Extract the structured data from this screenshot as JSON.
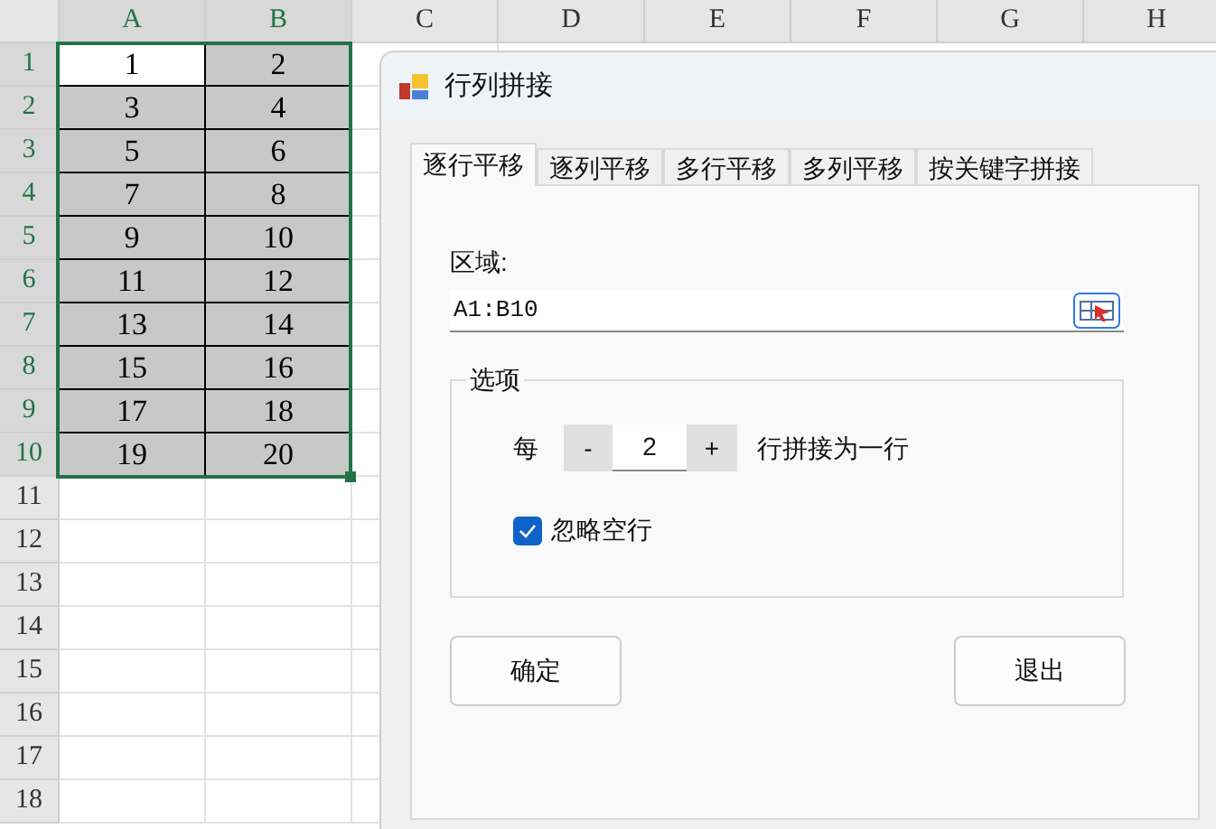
{
  "sheet": {
    "columns": [
      {
        "label": "A",
        "selected": true
      },
      {
        "label": "B",
        "selected": true
      },
      {
        "label": "C",
        "selected": false
      },
      {
        "label": "D",
        "selected": false
      },
      {
        "label": "E",
        "selected": false
      },
      {
        "label": "F",
        "selected": false
      },
      {
        "label": "G",
        "selected": false
      },
      {
        "label": "H",
        "selected": false
      }
    ],
    "rows": [
      {
        "label": "1",
        "selected": true,
        "cells": [
          {
            "value": "1",
            "active": true
          },
          {
            "value": "2",
            "active": false
          }
        ]
      },
      {
        "label": "2",
        "selected": true,
        "cells": [
          {
            "value": "3",
            "active": false
          },
          {
            "value": "4",
            "active": false
          }
        ]
      },
      {
        "label": "3",
        "selected": true,
        "cells": [
          {
            "value": "5",
            "active": false
          },
          {
            "value": "6",
            "active": false
          }
        ]
      },
      {
        "label": "4",
        "selected": true,
        "cells": [
          {
            "value": "7",
            "active": false
          },
          {
            "value": "8",
            "active": false
          }
        ]
      },
      {
        "label": "5",
        "selected": true,
        "cells": [
          {
            "value": "9",
            "active": false
          },
          {
            "value": "10",
            "active": false
          }
        ]
      },
      {
        "label": "6",
        "selected": true,
        "cells": [
          {
            "value": "11",
            "active": false
          },
          {
            "value": "12",
            "active": false
          }
        ]
      },
      {
        "label": "7",
        "selected": true,
        "cells": [
          {
            "value": "13",
            "active": false
          },
          {
            "value": "14",
            "active": false
          }
        ]
      },
      {
        "label": "8",
        "selected": true,
        "cells": [
          {
            "value": "15",
            "active": false
          },
          {
            "value": "16",
            "active": false
          }
        ]
      },
      {
        "label": "9",
        "selected": true,
        "cells": [
          {
            "value": "17",
            "active": false
          },
          {
            "value": "18",
            "active": false
          }
        ]
      },
      {
        "label": "10",
        "selected": true,
        "cells": [
          {
            "value": "19",
            "active": false
          },
          {
            "value": "20",
            "active": false
          }
        ]
      },
      {
        "label": "11",
        "selected": false
      },
      {
        "label": "12",
        "selected": false
      },
      {
        "label": "13",
        "selected": false
      },
      {
        "label": "14",
        "selected": false
      },
      {
        "label": "15",
        "selected": false
      },
      {
        "label": "16",
        "selected": false
      },
      {
        "label": "17",
        "selected": false
      },
      {
        "label": "18",
        "selected": false
      }
    ]
  },
  "dialog": {
    "title": "行列拼接",
    "tabs": [
      {
        "label": "逐行平移",
        "selected": true
      },
      {
        "label": "逐列平移",
        "selected": false
      },
      {
        "label": "多行平移",
        "selected": false
      },
      {
        "label": "多列平移",
        "selected": false
      },
      {
        "label": "按关键字拼接",
        "selected": false
      }
    ],
    "range_label": "区域:",
    "range_value": "A1:B10",
    "options": {
      "legend": "选项",
      "prefix": "每",
      "count": "2",
      "minus": "-",
      "plus": "+",
      "suffix": "行拼接为一行",
      "skip_empty": {
        "label": "忽略空行",
        "checked": true
      }
    },
    "buttons": [
      "确定",
      "退出"
    ]
  }
}
